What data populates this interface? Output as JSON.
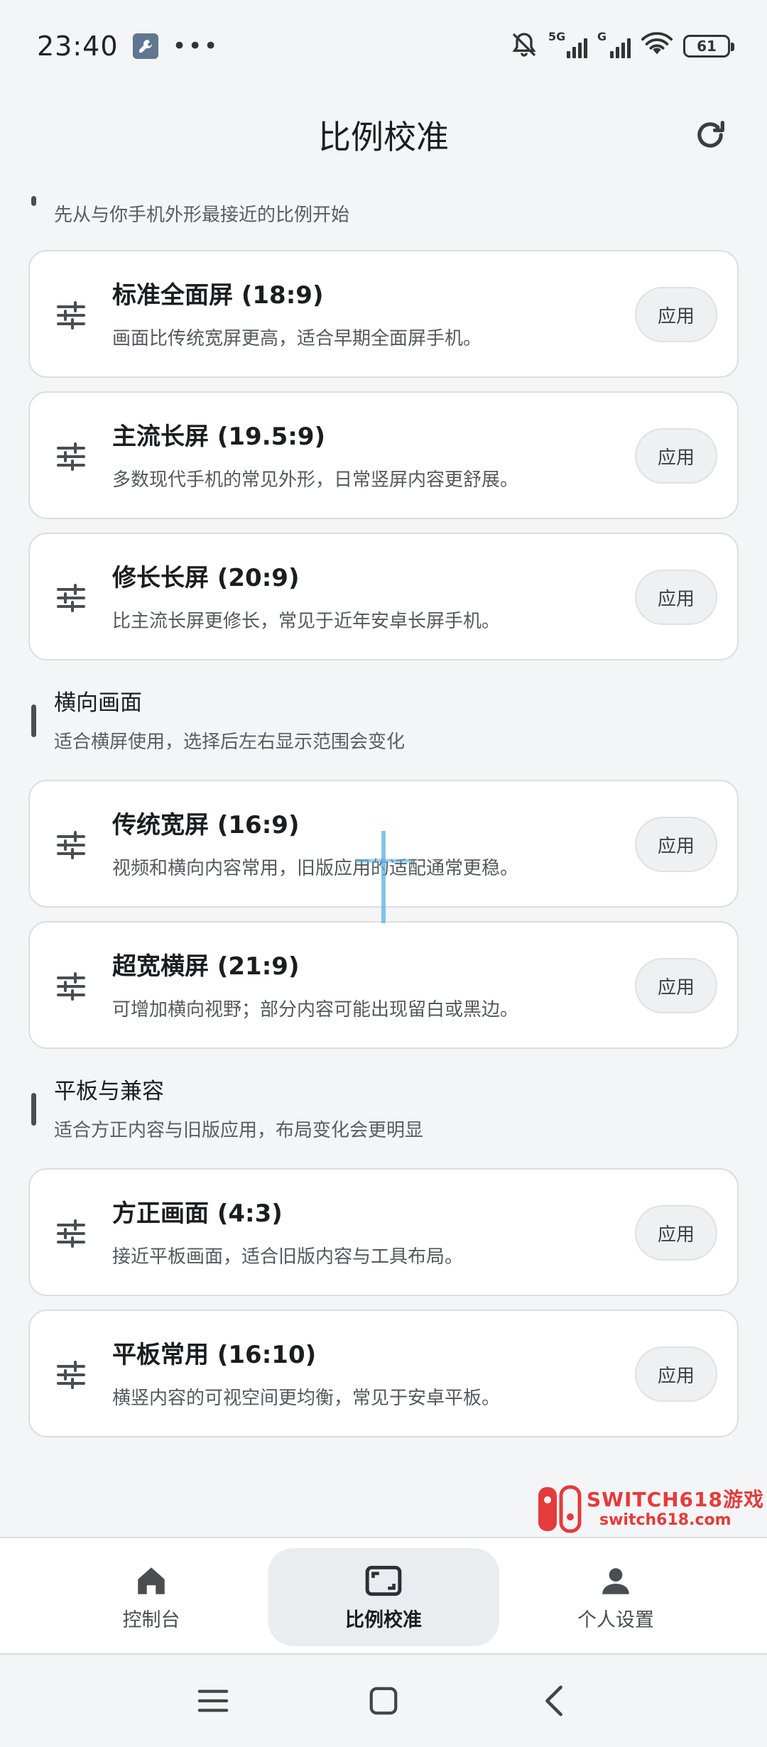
{
  "status_bar": {
    "time": "23:40",
    "signal_1_tag": "5G",
    "signal_2_tag": "G",
    "battery": "61"
  },
  "header": {
    "title": "比例校准"
  },
  "sections": [
    {
      "title": "",
      "desc": "先从与你手机外形最接近的比例开始",
      "cards": [
        {
          "title": "标准全面屏 (18:9)",
          "desc": "画面比传统宽屏更高，适合早期全面屏手机。",
          "button": "应用"
        },
        {
          "title": "主流长屏 (19.5:9)",
          "desc": "多数现代手机的常见外形，日常竖屏内容更舒展。",
          "button": "应用"
        },
        {
          "title": "修长长屏 (20:9)",
          "desc": "比主流长屏更修长，常见于近年安卓长屏手机。",
          "button": "应用"
        }
      ]
    },
    {
      "title": "横向画面",
      "desc": "适合横屏使用，选择后左右显示范围会变化",
      "cards": [
        {
          "title": "传统宽屏 (16:9)",
          "desc": "视频和横向内容常用，旧版应用的适配通常更稳。",
          "button": "应用"
        },
        {
          "title": "超宽横屏 (21:9)",
          "desc": "可增加横向视野；部分内容可能出现留白或黑边。",
          "button": "应用"
        }
      ]
    },
    {
      "title": "平板与兼容",
      "desc": "适合方正内容与旧版应用，布局变化会更明显",
      "cards": [
        {
          "title": "方正画面 (4:3)",
          "desc": "接近平板画面，适合旧版内容与工具布局。",
          "button": "应用"
        },
        {
          "title": "平板常用 (16:10)",
          "desc": "横竖内容的可视空间更均衡，常见于安卓平板。",
          "button": "应用"
        }
      ]
    }
  ],
  "watermark": {
    "line1": "SWITCH618游戏",
    "line2": "switch618.com"
  },
  "bottom_nav": [
    {
      "label": "控制台",
      "icon": "home-icon",
      "active": false
    },
    {
      "label": "比例校准",
      "icon": "aspect-ratio-icon",
      "active": true
    },
    {
      "label": "个人设置",
      "icon": "person-icon",
      "active": false
    }
  ],
  "colors": {
    "background": "#f4f5f6",
    "card": "#ffffff",
    "active_nav": "#eaedf0",
    "watermark_red": "#e43b3b"
  }
}
